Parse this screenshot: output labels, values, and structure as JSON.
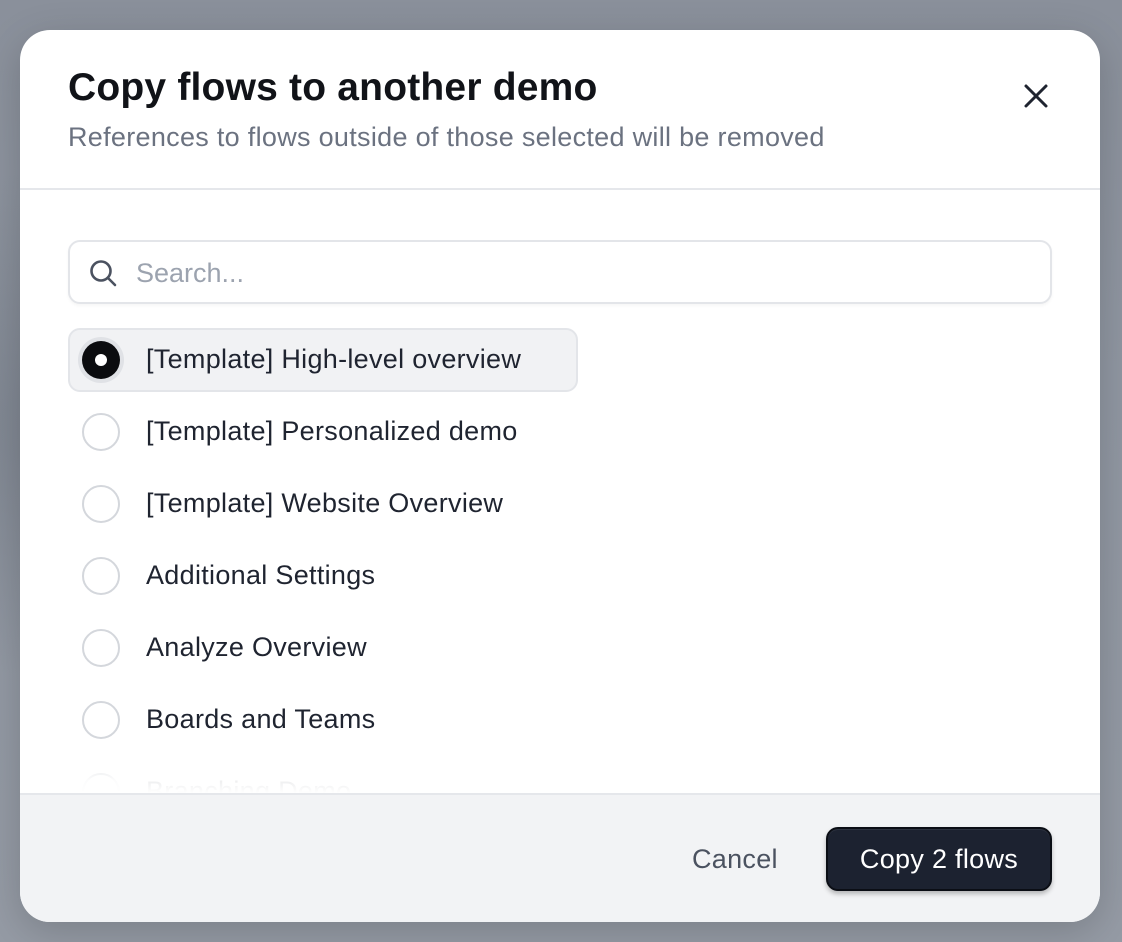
{
  "dialog": {
    "title": "Copy flows to another demo",
    "subtitle": "References to flows outside of those selected will be removed",
    "close_icon": "close-icon"
  },
  "search": {
    "placeholder": "Search...",
    "value": "",
    "icon": "search-icon"
  },
  "flows": [
    {
      "label": "[Template] High-level overview",
      "selected": true
    },
    {
      "label": "[Template] Personalized demo",
      "selected": false
    },
    {
      "label": "[Template] Website Overview",
      "selected": false
    },
    {
      "label": "Additional Settings",
      "selected": false
    },
    {
      "label": "Analyze Overview",
      "selected": false
    },
    {
      "label": "Boards and Teams",
      "selected": false
    },
    {
      "label": "Branching Demo",
      "selected": false
    }
  ],
  "footer": {
    "cancel_label": "Cancel",
    "copy_label": "Copy 2 flows"
  },
  "colors": {
    "primary_button": "#1c2230",
    "selected_radio": "#0b0c0f",
    "footer_bg": "#f2f3f5"
  }
}
